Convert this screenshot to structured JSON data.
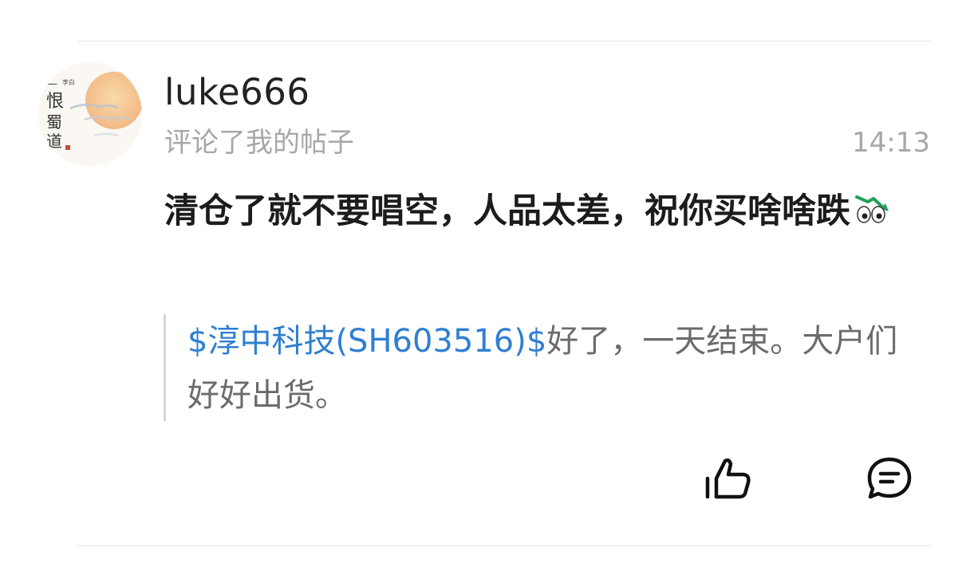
{
  "comment": {
    "username": "luke666",
    "action": "评论了我的帖子",
    "time": "14:13",
    "text": "清仓了就不要唱空，人品太差，祝你买啥啥跌",
    "emoji": "falling-stock-eyes-emoji"
  },
  "quote": {
    "stock_link": "$淳中科技(SH603516)$",
    "text": "好了，一天结束。大户们好好出货。"
  },
  "actions": {
    "like_icon": "thumbs-up-icon",
    "reply_icon": "comment-icon"
  },
  "colors": {
    "link": "#2f7fd1",
    "secondary_text": "#a7a7a7",
    "quote_text": "#6b6b6b",
    "quote_bar": "#d6d6d6"
  }
}
